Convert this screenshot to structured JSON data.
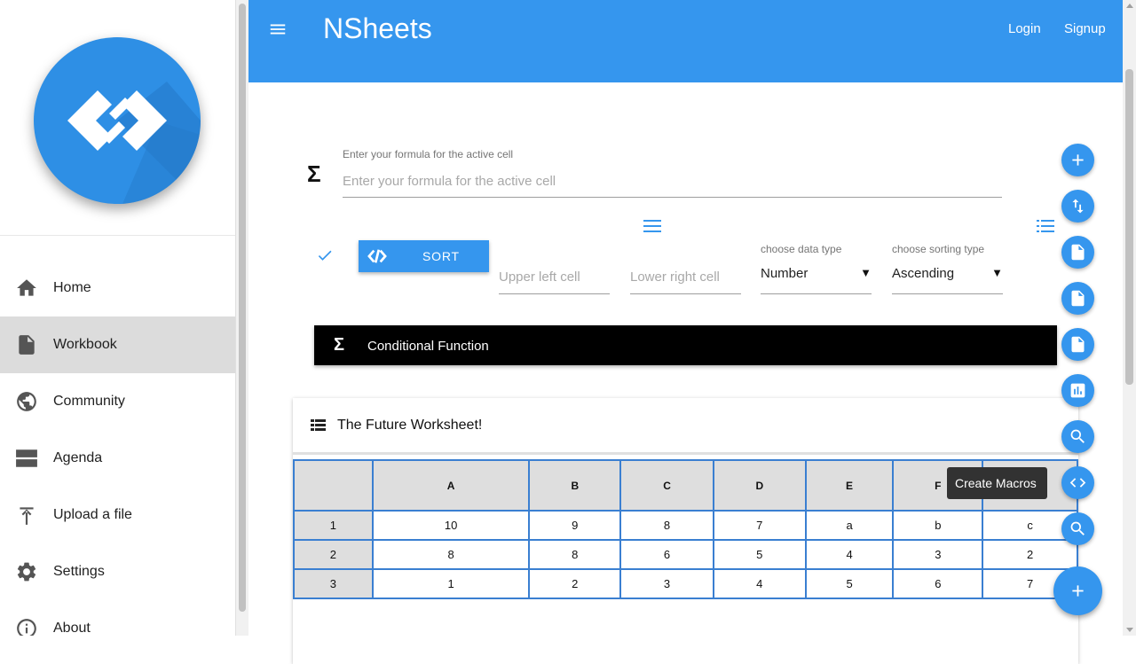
{
  "app": {
    "title": "NSheets"
  },
  "header": {
    "login": "Login",
    "signup": "Signup"
  },
  "sidebar": {
    "items": [
      {
        "label": "Home",
        "icon": "home-icon"
      },
      {
        "label": "Workbook",
        "icon": "file-icon",
        "active": true
      },
      {
        "label": "Community",
        "icon": "globe-icon"
      },
      {
        "label": "Agenda",
        "icon": "agenda-icon"
      },
      {
        "label": "Upload a file",
        "icon": "upload-icon"
      },
      {
        "label": "Settings",
        "icon": "gear-icon"
      },
      {
        "label": "About",
        "icon": "info-icon"
      }
    ]
  },
  "formula": {
    "label": "Enter your formula for the active cell",
    "placeholder": "Enter your formula for the active cell"
  },
  "sort": {
    "button_label": "SORT",
    "upper_left_placeholder": "Upper left cell",
    "lower_right_placeholder": "Lower right cell",
    "data_type_label": "choose data type",
    "data_type_value": "Number",
    "sorting_type_label": "choose sorting type",
    "sorting_type_value": "Ascending"
  },
  "conditional": {
    "label": "Conditional Function"
  },
  "worksheet": {
    "title": "The Future Worksheet!",
    "columns": [
      "",
      "A",
      "B",
      "C",
      "D",
      "E",
      "F",
      ""
    ],
    "rows": [
      {
        "head": "1",
        "cells": [
          "10",
          "9",
          "8",
          "7",
          "a",
          "b",
          "c"
        ]
      },
      {
        "head": "2",
        "cells": [
          "8",
          "8",
          "6",
          "5",
          "4",
          "3",
          "2"
        ]
      },
      {
        "head": "3",
        "cells": [
          "1",
          "2",
          "3",
          "4",
          "5",
          "6",
          "7"
        ]
      }
    ]
  },
  "fabs": [
    "add-icon",
    "swap-vert-icon",
    "file-icon",
    "file-icon",
    "file-icon",
    "bar-chart-icon",
    "search-icon",
    "code-icon",
    "search-icon"
  ],
  "tooltip": {
    "text": "Create Macros"
  },
  "colors": {
    "primary": "#3596ee",
    "active_nav": "#dcdcdc",
    "table_border": "#3a7fd1"
  }
}
